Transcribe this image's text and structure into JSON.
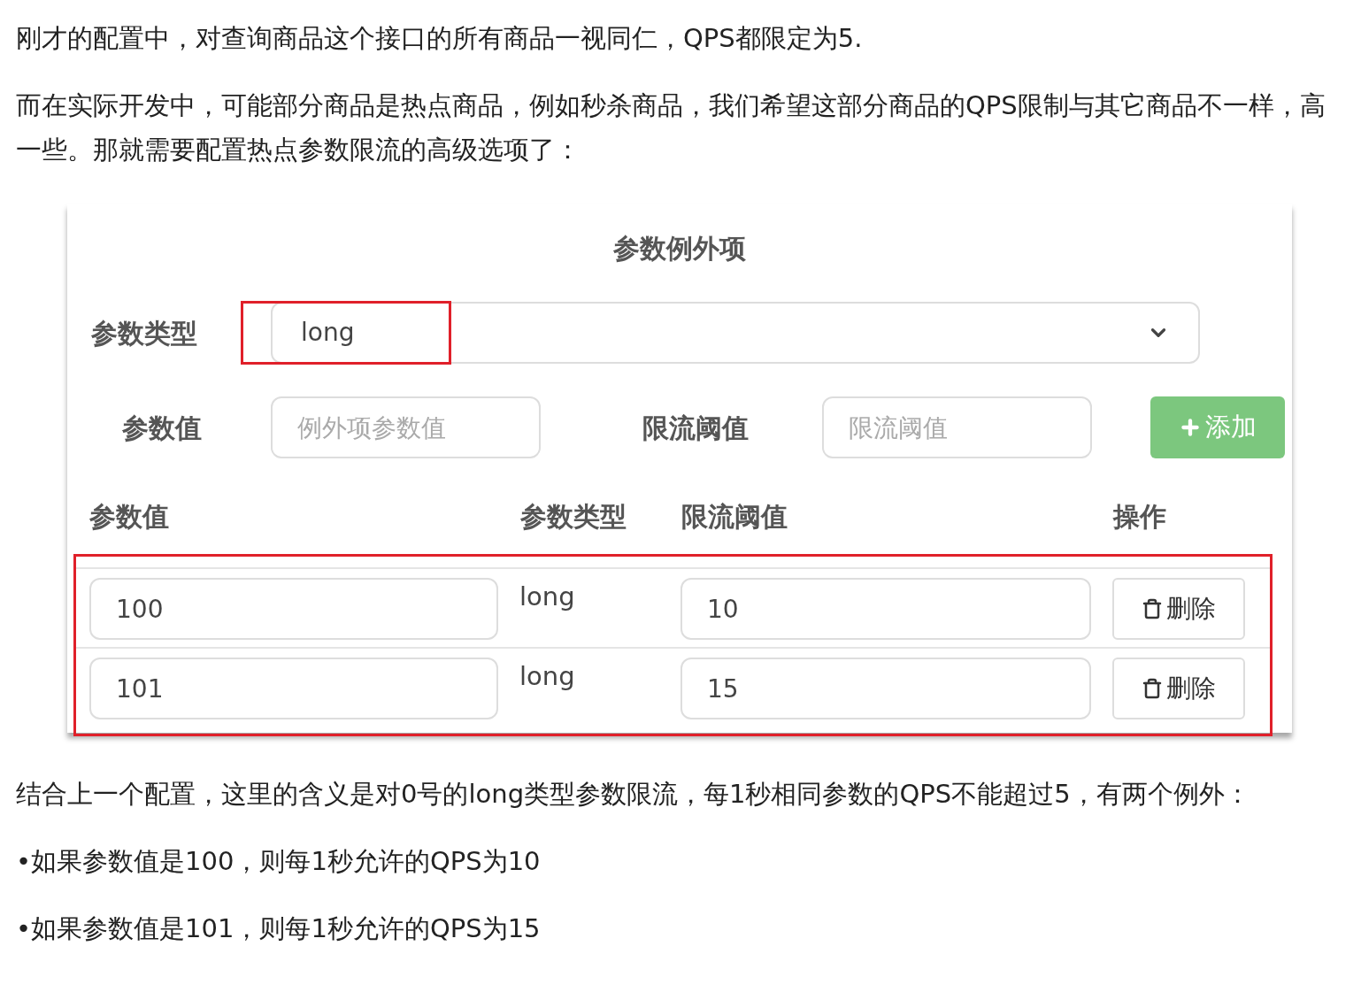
{
  "intro": [
    "刚才的配置中，对查询商品这个接口的所有商品一视同仁，QPS都限定为5.",
    "而在实际开发中，可能部分商品是热点商品，例如秒杀商品，我们希望这部分商品的QPS限制与其它商品不一样，高一些。那就需要配置热点参数限流的高级选项了："
  ],
  "panel": {
    "title": "参数例外项",
    "param_type": {
      "label": "参数类型",
      "value": "long"
    },
    "form": {
      "value_label": "参数值",
      "value_placeholder": "例外项参数值",
      "threshold_label": "限流阈值",
      "threshold_placeholder": "限流阈值",
      "add_button": "添加"
    },
    "table": {
      "columns": [
        "参数值",
        "参数类型",
        "限流阈值",
        "操作"
      ],
      "rows": [
        {
          "value": "100",
          "type": "long",
          "threshold": "10",
          "action": "删除"
        },
        {
          "value": "101",
          "type": "long",
          "threshold": "15",
          "action": "删除"
        }
      ]
    }
  },
  "outro": "结合上一个配置，这里的含义是对0号的long类型参数限流，每1秒相同参数的QPS不能超过5，有两个例外：",
  "bullets": [
    "•如果参数值是100，则每1秒允许的QPS为10",
    "•如果参数值是101，则每1秒允许的QPS为15"
  ]
}
